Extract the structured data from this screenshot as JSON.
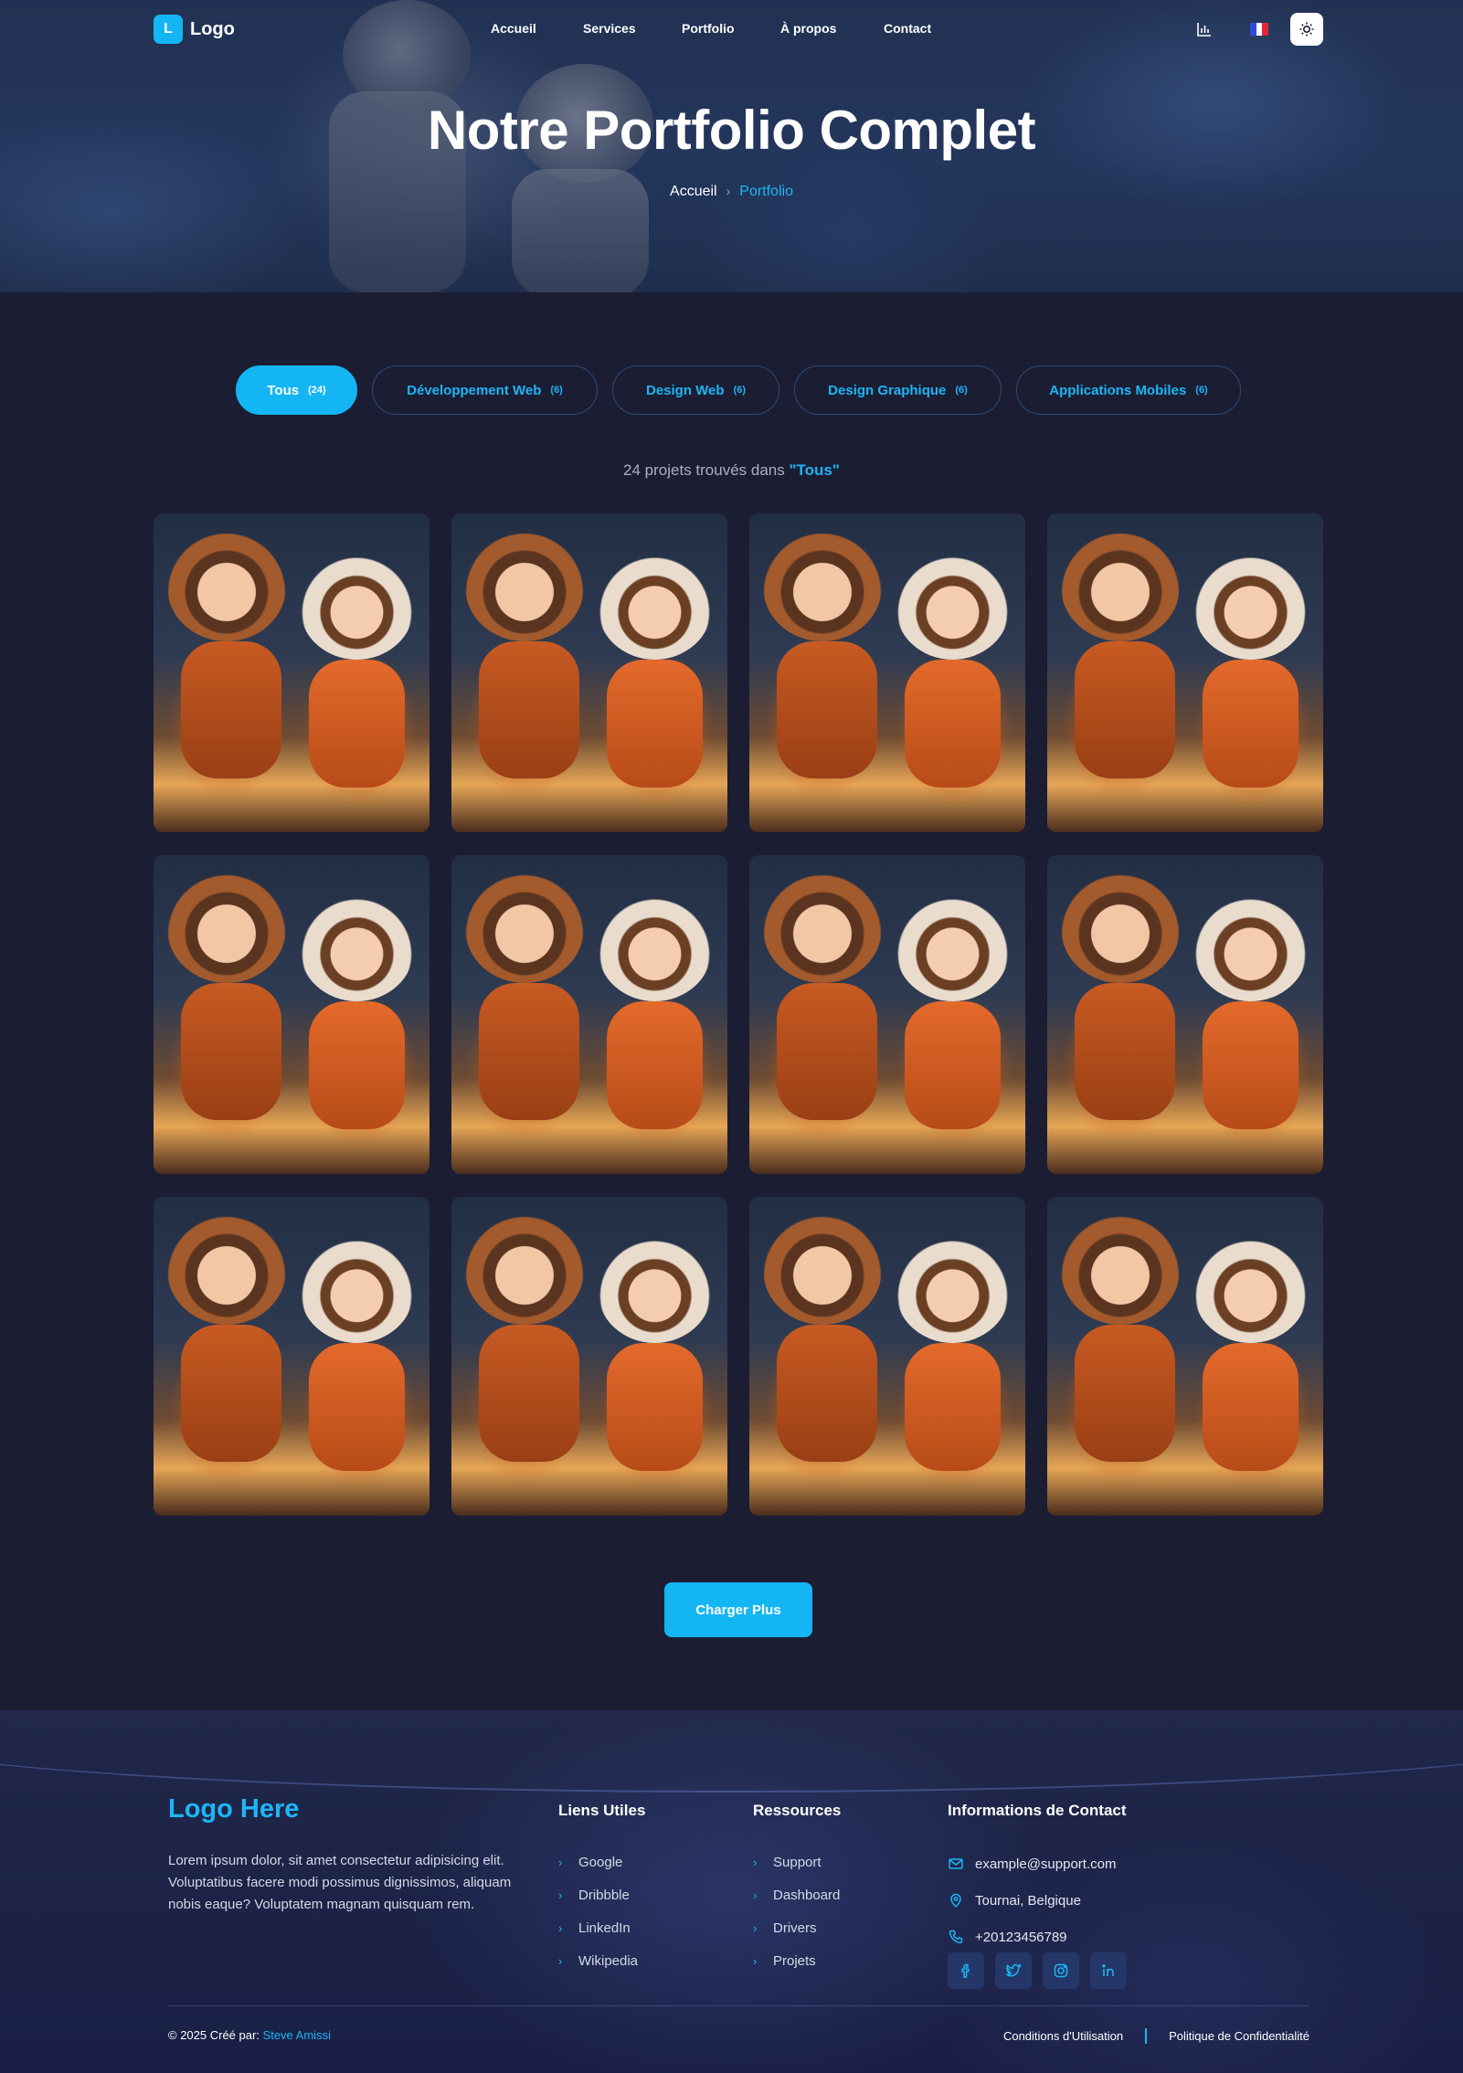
{
  "nav": {
    "logo_letter": "L",
    "logo_text": "Logo",
    "links": [
      "Accueil",
      "Services",
      "Portfolio",
      "À propos",
      "Contact"
    ],
    "icons": [
      "chart-icon",
      "france-flag-icon",
      "sun-icon"
    ]
  },
  "hero": {
    "title": "Notre Portfolio Complet",
    "breadcrumb": {
      "home": "Accueil",
      "separator": "›",
      "current": "Portfolio"
    }
  },
  "filters": [
    {
      "label": "Tous",
      "count": "(24)",
      "active": true
    },
    {
      "label": "Développement Web",
      "count": "(6)",
      "active": false
    },
    {
      "label": "Design Web",
      "count": "(6)",
      "active": false
    },
    {
      "label": "Design Graphique",
      "count": "(6)",
      "active": false
    },
    {
      "label": "Applications Mobiles",
      "count": "(6)",
      "active": false
    }
  ],
  "results": {
    "prefix": "24 projets trouvés dans",
    "category": "\"Tous\""
  },
  "load_more_label": "Charger Plus",
  "footer": {
    "logo": "Logo Here",
    "description": "Lorem ipsum dolor, sit amet consectetur adipisicing elit. Voluptatibus facere modi possimus dignissimos, aliquam nobis eaque? Voluptatem magnam quisquam rem.",
    "useful_links_title": "Liens Utiles",
    "useful_links": [
      "Google",
      "Dribbble",
      "LinkedIn",
      "Wikipedia"
    ],
    "resources_title": "Ressources",
    "resources": [
      "Support",
      "Dashboard",
      "Drivers",
      "Projets"
    ],
    "contact_title": "Informations de Contact",
    "contact": {
      "email": "example@support.com",
      "location": "Tournai, Belgique",
      "phone": "+20123456789"
    },
    "socials": [
      "facebook-icon",
      "twitter-icon",
      "instagram-icon",
      "linkedin-icon"
    ],
    "copyright_prefix": "© 2025 Créé par:",
    "author": "Steve Amissi",
    "terms": "Conditions d'Utilisation",
    "privacy": "Politique de Confidentialité"
  },
  "colors": {
    "accent": "#14b5f3",
    "background": "#1b1d33",
    "footer": "#1c2347"
  }
}
